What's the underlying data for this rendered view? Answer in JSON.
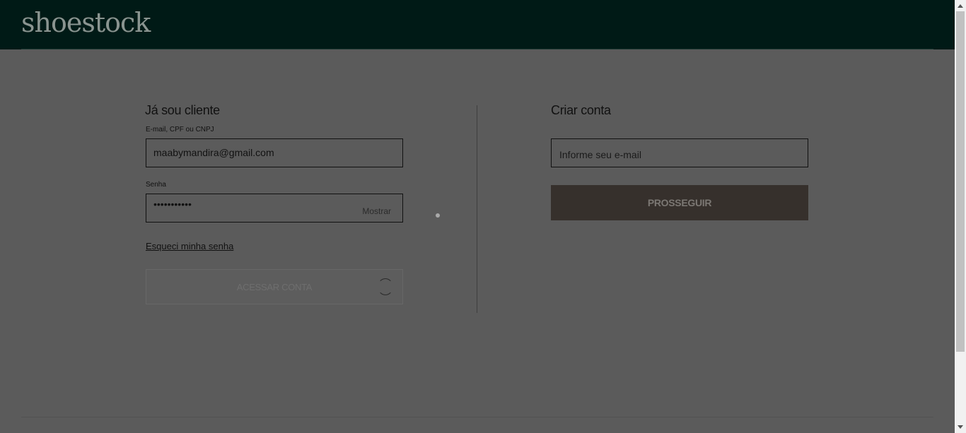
{
  "header": {
    "logo": "shoestock"
  },
  "login": {
    "title": "Já sou cliente",
    "email_label": "E-mail, CPF ou CNPJ",
    "email_value": "maabymandira@gmail.com",
    "password_label": "Senha",
    "password_value": "•••••••••••",
    "show_label": "Mostrar",
    "forgot_label": "Esqueci minha senha",
    "submit_label": "ACESSAR CONTA"
  },
  "create": {
    "title": "Criar conta",
    "email_placeholder": "Informe seu e-mail",
    "submit_label": "PROSSEGUIR"
  }
}
